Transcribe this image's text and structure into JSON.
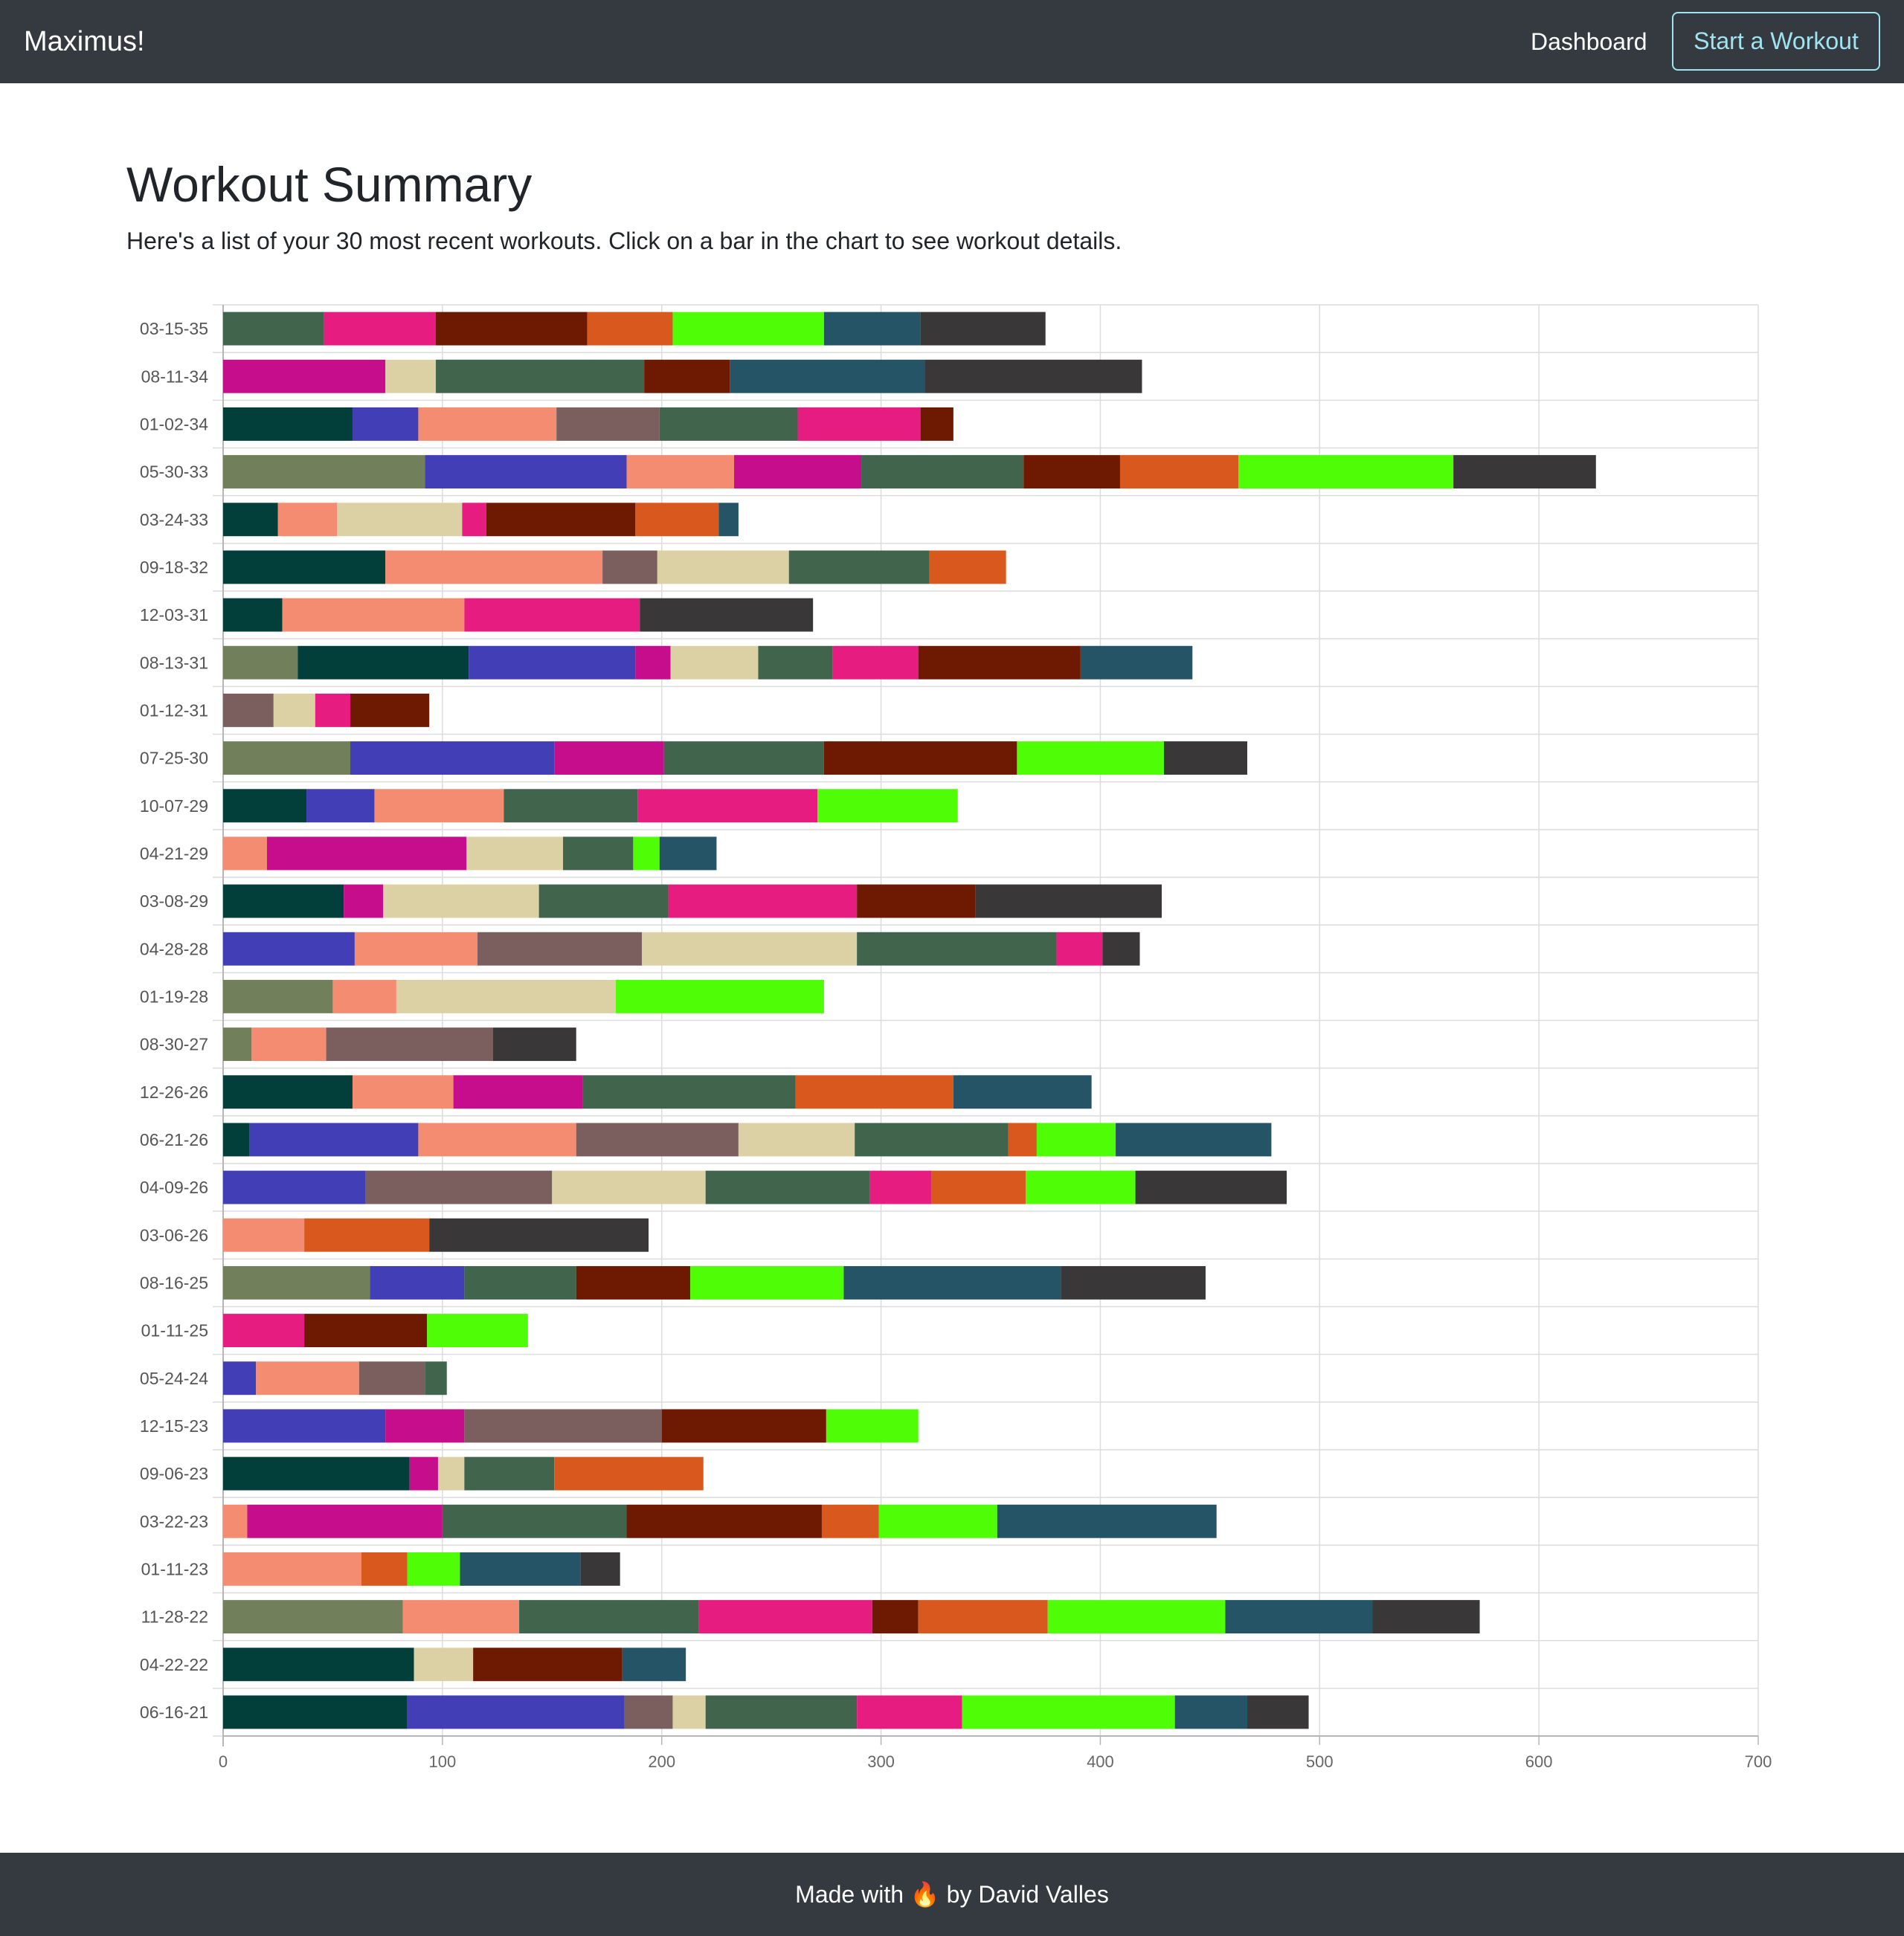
{
  "navbar": {
    "brand": "Maximus!",
    "dashboard_label": "Dashboard",
    "start_workout_label": "Start a Workout",
    "accent_color": "#9fe4f0",
    "background_color": "#343a40"
  },
  "page": {
    "title": "Workout Summary",
    "subtitle": "Here's a list of your 30 most recent workouts. Click on a bar in the chart to see workout details."
  },
  "footer": {
    "prefix": "Made with",
    "icon": "fire-icon",
    "icon_glyph": "🔥",
    "suffix": "by David Valles"
  },
  "chart_data": {
    "type": "bar",
    "orientation": "horizontal",
    "stacked": true,
    "title": "",
    "xlabel": "",
    "ylabel": "",
    "xlim": [
      0,
      700
    ],
    "xticks": [
      0,
      100,
      200,
      300,
      400,
      500,
      600,
      700
    ],
    "grid": true,
    "legend": "none",
    "categories": [
      "03-15-35",
      "08-11-34",
      "01-02-34",
      "05-30-33",
      "03-24-33",
      "09-18-32",
      "12-03-31",
      "08-13-31",
      "01-12-31",
      "07-25-30",
      "10-07-29",
      "04-21-29",
      "03-08-29",
      "04-28-28",
      "01-19-28",
      "08-30-27",
      "12-26-26",
      "06-21-26",
      "04-09-26",
      "03-06-26",
      "08-16-25",
      "01-11-25",
      "05-24-24",
      "12-15-23",
      "09-06-23",
      "03-22-23",
      "01-11-23",
      "11-28-22",
      "04-22-22",
      "06-16-21"
    ],
    "series_colors": [
      "#71805b",
      "#023f3b",
      "#423eb6",
      "#f48c72",
      "#c60d8b",
      "#7b5f5e",
      "#dbd1a4",
      "#41644c",
      "#e61c81",
      "#6e1a03",
      "#d9581e",
      "#4ffd06",
      "#245466",
      "#393737"
    ],
    "series": [
      {
        "values": [
          0,
          0,
          0,
          92,
          0,
          0,
          0,
          34,
          0,
          58,
          0,
          0,
          0,
          0,
          50,
          13,
          0,
          0,
          0,
          0,
          67,
          0,
          0,
          0,
          0,
          0,
          0,
          82,
          0,
          0
        ]
      },
      {
        "values": [
          0,
          0,
          59,
          0,
          25,
          74,
          27,
          78,
          0,
          0,
          38,
          0,
          55,
          0,
          0,
          0,
          59,
          12,
          0,
          0,
          0,
          0,
          0,
          0,
          85,
          0,
          0,
          0,
          87,
          84
        ]
      },
      {
        "values": [
          0,
          0,
          30,
          92,
          0,
          0,
          0,
          76,
          0,
          93,
          31,
          0,
          0,
          60,
          0,
          0,
          0,
          77,
          65,
          0,
          43,
          0,
          15,
          74,
          0,
          0,
          0,
          0,
          0,
          99
        ]
      },
      {
        "values": [
          0,
          0,
          63,
          49,
          27,
          99,
          83,
          0,
          0,
          0,
          59,
          20,
          0,
          56,
          29,
          34,
          46,
          72,
          0,
          37,
          0,
          0,
          47,
          0,
          0,
          11,
          63,
          53,
          0,
          0
        ]
      },
      {
        "values": [
          0,
          74,
          0,
          58,
          0,
          0,
          0,
          16,
          0,
          50,
          0,
          91,
          18,
          0,
          0,
          0,
          59,
          0,
          0,
          0,
          0,
          0,
          0,
          36,
          13,
          89,
          0,
          0,
          0,
          0
        ]
      },
      {
        "values": [
          0,
          0,
          47,
          0,
          0,
          25,
          0,
          0,
          23,
          0,
          0,
          0,
          0,
          75,
          0,
          76,
          0,
          74,
          85,
          0,
          0,
          0,
          30,
          90,
          0,
          0,
          0,
          0,
          0,
          22
        ]
      },
      {
        "values": [
          0,
          23,
          0,
          0,
          57,
          60,
          0,
          40,
          19,
          0,
          0,
          44,
          71,
          98,
          100,
          0,
          0,
          53,
          70,
          0,
          0,
          0,
          0,
          0,
          12,
          0,
          0,
          0,
          27,
          15
        ]
      },
      {
        "values": [
          46,
          95,
          63,
          74,
          0,
          64,
          0,
          34,
          0,
          73,
          61,
          32,
          59,
          91,
          0,
          0,
          97,
          70,
          75,
          0,
          51,
          0,
          10,
          0,
          41,
          84,
          0,
          82,
          0,
          69
        ]
      },
      {
        "values": [
          51,
          0,
          56,
          0,
          11,
          0,
          80,
          39,
          16,
          0,
          82,
          0,
          86,
          21,
          0,
          0,
          0,
          0,
          28,
          0,
          0,
          37,
          0,
          0,
          0,
          0,
          0,
          79,
          0,
          48
        ]
      },
      {
        "values": [
          69,
          39,
          15,
          44,
          68,
          0,
          0,
          74,
          36,
          88,
          0,
          0,
          54,
          0,
          0,
          0,
          0,
          0,
          0,
          0,
          52,
          56,
          0,
          75,
          0,
          89,
          0,
          21,
          68,
          0
        ]
      },
      {
        "values": [
          39,
          0,
          0,
          54,
          38,
          35,
          0,
          0,
          0,
          0,
          0,
          0,
          0,
          0,
          0,
          0,
          72,
          13,
          43,
          57,
          0,
          0,
          0,
          0,
          68,
          26,
          21,
          59,
          0,
          0
        ]
      },
      {
        "values": [
          69,
          0,
          0,
          98,
          0,
          0,
          0,
          0,
          0,
          67,
          64,
          12,
          0,
          0,
          95,
          0,
          0,
          36,
          50,
          0,
          70,
          46,
          0,
          42,
          0,
          54,
          24,
          81,
          0,
          97
        ]
      },
      {
        "values": [
          44,
          89,
          0,
          0,
          9,
          0,
          0,
          51,
          0,
          0,
          0,
          26,
          0,
          0,
          0,
          0,
          63,
          71,
          0,
          0,
          99,
          0,
          0,
          0,
          0,
          100,
          55,
          67,
          29,
          33
        ]
      },
      {
        "values": [
          57,
          99,
          0,
          65,
          0,
          0,
          79,
          0,
          0,
          38,
          0,
          0,
          85,
          17,
          0,
          38,
          0,
          0,
          69,
          100,
          66,
          0,
          0,
          0,
          0,
          0,
          18,
          49,
          0,
          28
        ]
      }
    ]
  }
}
